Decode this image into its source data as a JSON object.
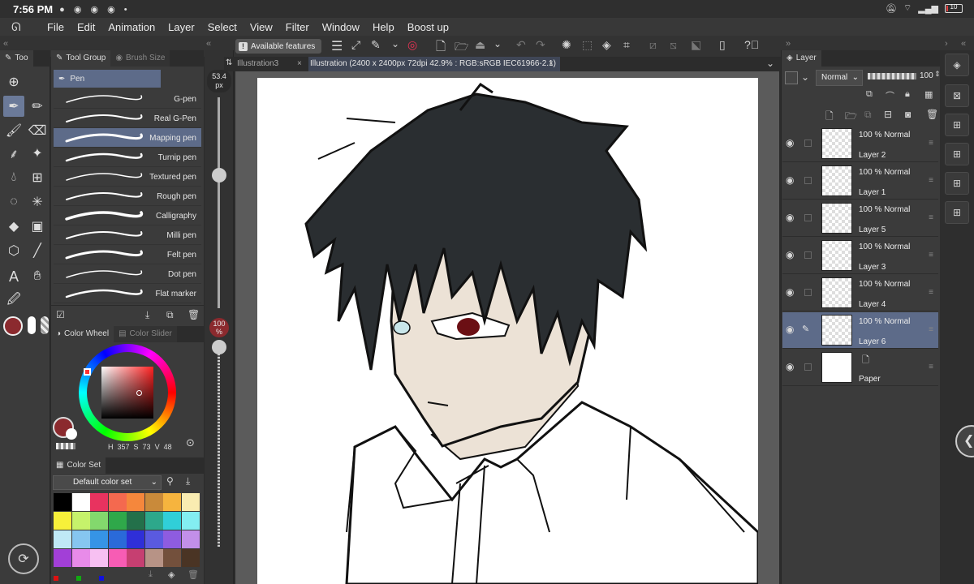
{
  "status_bar": {
    "time": "7:56 PM",
    "battery_text": "10"
  },
  "menu": [
    "File",
    "Edit",
    "Animation",
    "Layer",
    "Select",
    "View",
    "Filter",
    "Window",
    "Help",
    "Boost up"
  ],
  "toolbar": {
    "available_features": "Available features"
  },
  "tool_panel": {
    "tab_tool": "Too",
    "tab_tool_group": "Tool Group",
    "tab_brush_size": "Brush Size",
    "group_name": "Pen"
  },
  "brushes": [
    "G-pen",
    "Real G-Pen",
    "Mapping pen",
    "Turnip pen",
    "Textured pen",
    "Rough pen",
    "Calligraphy",
    "Milli pen",
    "Felt pen",
    "Dot pen",
    "Flat marker"
  ],
  "size_slider": {
    "size_value": "53.4",
    "size_unit": "px",
    "opacity_value": "100",
    "opacity_unit": "%"
  },
  "color_panel": {
    "tab_color_wheel": "Color Wheel",
    "tab_color_slider": "Color Slider",
    "h": "357",
    "s": "73",
    "v": "48",
    "main_color": "#8b2a2e",
    "color_set_title": "Color Set",
    "color_set_select": "Default color set",
    "swatches": [
      "#000000",
      "#ffffff",
      "#e8335f",
      "#f4694f",
      "#f5873c",
      "#c98a3a",
      "#f6b43e",
      "#f9ecb1",
      "#f7f03a",
      "#c6f26b",
      "#83d86d",
      "#2fa84a",
      "#23704a",
      "#2da88b",
      "#30cfd8",
      "#83eef1",
      "#bfe9f6",
      "#86c6f0",
      "#3694e6",
      "#2a6ad9",
      "#2f2fd8",
      "#5a5ae0",
      "#8e5ce0",
      "#c28fe9",
      "#a23fd7",
      "#e88be9",
      "#f7c0f2",
      "#f75cb4",
      "#c63f71",
      "#b79386",
      "#73503c",
      "#4a3424"
    ]
  },
  "tabs": {
    "doc1": "Illustration3",
    "doc2": "Illustration (2400 x 2400px 72dpi 42.9% : RGB:sRGB IEC61966-2.1)"
  },
  "layer_panel": {
    "title": "Layer",
    "blend_mode": "Normal",
    "opacity": "100",
    "layers": [
      {
        "mode": "100 % Normal",
        "name": "Layer 2"
      },
      {
        "mode": "100 % Normal",
        "name": "Layer 1"
      },
      {
        "mode": "100 % Normal",
        "name": "Layer 5"
      },
      {
        "mode": "100 % Normal",
        "name": "Layer 3"
      },
      {
        "mode": "100 % Normal",
        "name": "Layer 4"
      },
      {
        "mode": "100 % Normal",
        "name": "Layer 6"
      },
      {
        "mode": "",
        "name": "Paper"
      }
    ]
  }
}
